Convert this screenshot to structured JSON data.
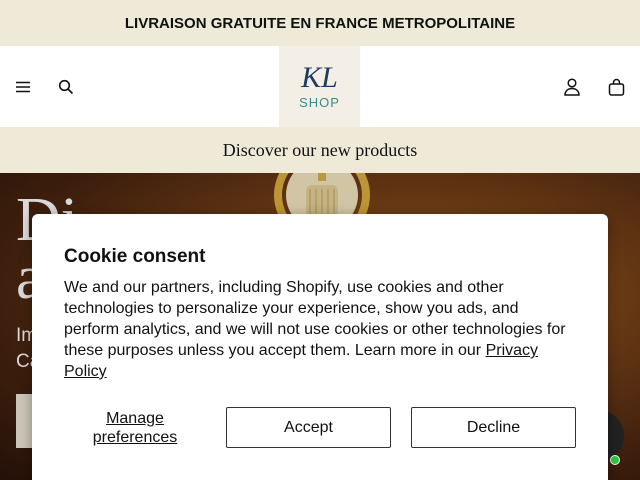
{
  "announcement": {
    "text": "LIVRAISON GRATUITE EN FRANCE METROPOLITAINE"
  },
  "header": {
    "logo_mark": "KL",
    "logo_text": "SHOP",
    "icons": [
      "menu-icon",
      "search-icon",
      "account-icon",
      "cart-icon"
    ]
  },
  "discover_bar": {
    "text": "Discover our new products"
  },
  "hero": {
    "title_line1": "Di",
    "title_line2": "a",
    "sub_line1": "Im",
    "sub_line2": "Ca"
  },
  "cookie": {
    "title": "Cookie consent",
    "body": "We and our partners, including Shopify, use cookies and other technologies to personalize your experience, show you ads, and perform analytics, and we will not use cookies or other technologies for these purposes unless you accept them. Learn more in our ",
    "privacy_link": "Privacy Policy",
    "manage_label": "Manage preferences",
    "accept_label": "Accept",
    "decline_label": "Decline"
  },
  "colors": {
    "announcement_bg": "#efe9d8",
    "logo_navy": "#1f3b60",
    "logo_teal": "#3a8a8a",
    "chat_online": "#2ecc40"
  }
}
